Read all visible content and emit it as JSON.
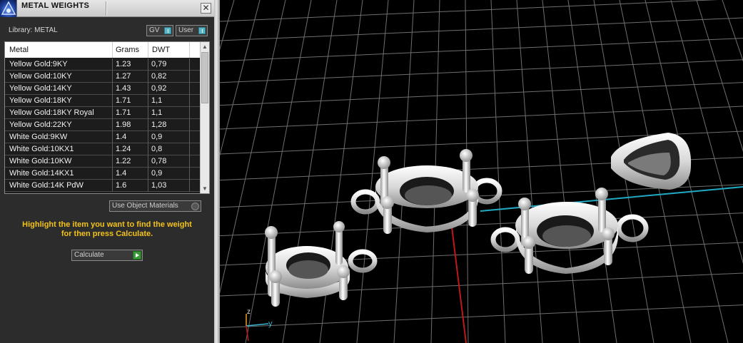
{
  "panel": {
    "title": "METAL WEIGHTS",
    "close_glyph": "✕",
    "library_label": "Library: METAL",
    "filters": [
      {
        "label": "GV"
      },
      {
        "label": "User"
      }
    ],
    "table": {
      "columns": [
        "Metal",
        "Grams",
        "DWT"
      ],
      "rows": [
        {
          "metal": "Yellow Gold:9KY",
          "grams": "1.23",
          "dwt": "0,79"
        },
        {
          "metal": "Yellow Gold:10KY",
          "grams": "1.27",
          "dwt": "0,82"
        },
        {
          "metal": "Yellow Gold:14KY",
          "grams": "1.43",
          "dwt": "0,92"
        },
        {
          "metal": "Yellow Gold:18KY",
          "grams": "1.71",
          "dwt": "1,1"
        },
        {
          "metal": "Yellow Gold:18KY Royal",
          "grams": "1.71",
          "dwt": "1,1"
        },
        {
          "metal": "Yellow Gold:22KY",
          "grams": "1.98",
          "dwt": "1,28"
        },
        {
          "metal": "White Gold:9KW",
          "grams": "1.4",
          "dwt": "0,9"
        },
        {
          "metal": "White Gold:10KX1",
          "grams": "1.24",
          "dwt": "0,8"
        },
        {
          "metal": "White Gold:10KW",
          "grams": "1.22",
          "dwt": "0,78"
        },
        {
          "metal": "White Gold:14KX1",
          "grams": "1.4",
          "dwt": "0,9"
        },
        {
          "metal": "White Gold:14K PdW",
          "grams": "1.6",
          "dwt": "1,03"
        }
      ],
      "scroll_up_glyph": "▲",
      "scroll_down_glyph": "▼"
    },
    "use_object_materials_label": "Use Object Materials",
    "hint_line1": "Highlight the item you want to find the weight",
    "hint_line2": "for then press Calculate.",
    "calculate_label": "Calculate"
  },
  "viewport": {
    "axis_labels": {
      "z": "z",
      "y": "y"
    },
    "objects": [
      {
        "name": "small-oval-setting"
      },
      {
        "name": "large-oval-setting-left"
      },
      {
        "name": "large-oval-setting-right"
      },
      {
        "name": "bail-loop"
      }
    ]
  },
  "colors": {
    "hint": "#f2c21a",
    "toggle": "#5ab7c7",
    "calc_go": "#3a9a3a",
    "grid": "#6e6e6e",
    "axis_red": "#c01818",
    "axis_cyan": "#22a9c4"
  },
  "icons": {
    "logo": "app-logo-icon",
    "close": "close-icon",
    "toggle": "toggle-icon",
    "go": "play-arrow-icon"
  }
}
